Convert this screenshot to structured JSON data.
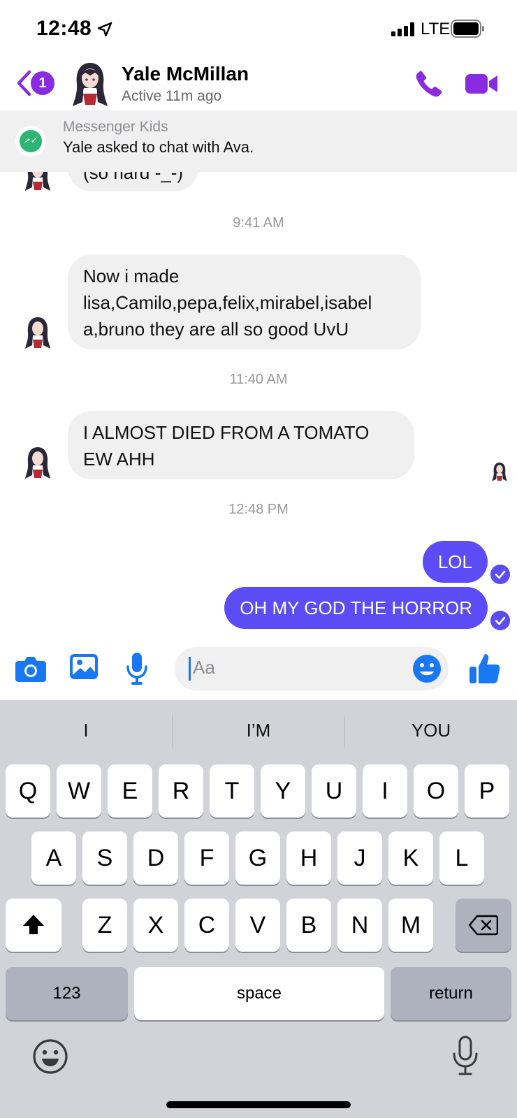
{
  "status_bar": {
    "time": "12:48",
    "network": "LTE"
  },
  "header": {
    "back_badge": "1",
    "name": "Yale McMillan",
    "status": "Active 11m ago",
    "accent_color": "#8a2be2"
  },
  "banner": {
    "title": "Messenger Kids",
    "text": "Yale asked to chat with Ava."
  },
  "messages": [
    {
      "type": "incoming",
      "text": "(so hard -_-)"
    },
    {
      "type": "timestamp",
      "text": "9:41 AM"
    },
    {
      "type": "incoming",
      "lines": [
        "Now i made",
        "lisa,Camilo,pepa,felix,mirabel,isabel",
        "a,bruno they are all so good UvU"
      ]
    },
    {
      "type": "timestamp",
      "text": "11:40 AM"
    },
    {
      "type": "incoming",
      "lines": [
        "I ALMOST DIED FROM A TOMATO",
        "EW AHH"
      ]
    },
    {
      "type": "timestamp",
      "text": "12:48 PM"
    },
    {
      "type": "outgoing",
      "text": "LOL"
    },
    {
      "type": "outgoing",
      "text": "OH MY GOD THE HORROR"
    }
  ],
  "input": {
    "placeholder": "Aa"
  },
  "keyboard": {
    "suggestions": [
      "I",
      "I’M",
      "YOU"
    ],
    "row1": [
      "Q",
      "W",
      "E",
      "R",
      "T",
      "Y",
      "U",
      "I",
      "O",
      "P"
    ],
    "row2": [
      "A",
      "S",
      "D",
      "F",
      "G",
      "H",
      "J",
      "K",
      "L"
    ],
    "row3": [
      "Z",
      "X",
      "C",
      "V",
      "B",
      "N",
      "M"
    ],
    "numbers_key": "123",
    "space_key": "space",
    "return_key": "return"
  },
  "colors": {
    "outgoing_bubble": "#5b4cf5",
    "icon_blue": "#1877f2",
    "incoming_bubble": "#f0f0f0"
  }
}
